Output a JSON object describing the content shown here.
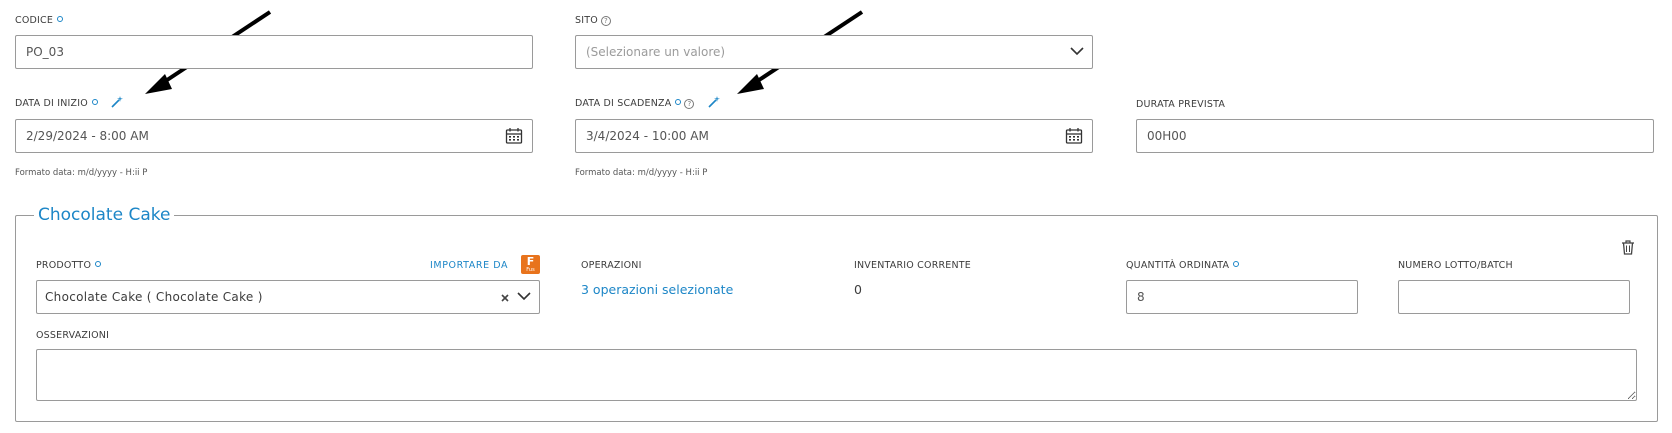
{
  "top": {
    "codice": {
      "label": "CODICE",
      "value": "PO_03"
    },
    "sito": {
      "label": "SITO",
      "placeholder": "(Selezionare un valore)"
    },
    "data_inizio": {
      "label": "DATA DI INIZIO",
      "value": "2/29/2024 - 8:00 AM",
      "hint": "Formato data: m/d/yyyy - H:ii P"
    },
    "data_scadenza": {
      "label": "DATA DI SCADENZA",
      "value": "3/4/2024 - 10:00 AM",
      "hint": "Formato data: m/d/yyyy - H:ii P"
    },
    "durata": {
      "label": "DURATA PREVISTA",
      "value": "00H00"
    }
  },
  "product_group": {
    "title": "Chocolate Cake",
    "prodotto": {
      "label": "PRODOTTO",
      "import_label": "IMPORTARE DA",
      "import_badge": "F",
      "import_badge_sub": "Fus",
      "value": "Chocolate Cake ( Chocolate Cake )"
    },
    "operazioni": {
      "label": "OPERAZIONI",
      "value": "3 operazioni selezionate"
    },
    "inventario": {
      "label": "INVENTARIO CORRENTE",
      "value": "0"
    },
    "quantita": {
      "label": "QUANTITÀ ORDINATA",
      "value": "8"
    },
    "lotto": {
      "label": "NUMERO LOTTO/BATCH",
      "value": ""
    },
    "osservazioni": {
      "label": "OSSERVAZIONI",
      "value": ""
    }
  },
  "icons": {
    "required": "required-dot-icon",
    "help": "help-circle-icon",
    "wand": "magic-wand-icon",
    "calendar": "calendar-icon",
    "chevron": "chevron-down-icon",
    "clear": "clear-x-icon",
    "trash": "trash-icon",
    "arrow": "annotation-arrow-icon",
    "fusion": "fusion-logo-icon"
  },
  "colors": {
    "accent": "#1c86c7",
    "fusion_orange": "#e8731c",
    "border": "#9a9a9a",
    "annotation_arrow": "#000000"
  }
}
